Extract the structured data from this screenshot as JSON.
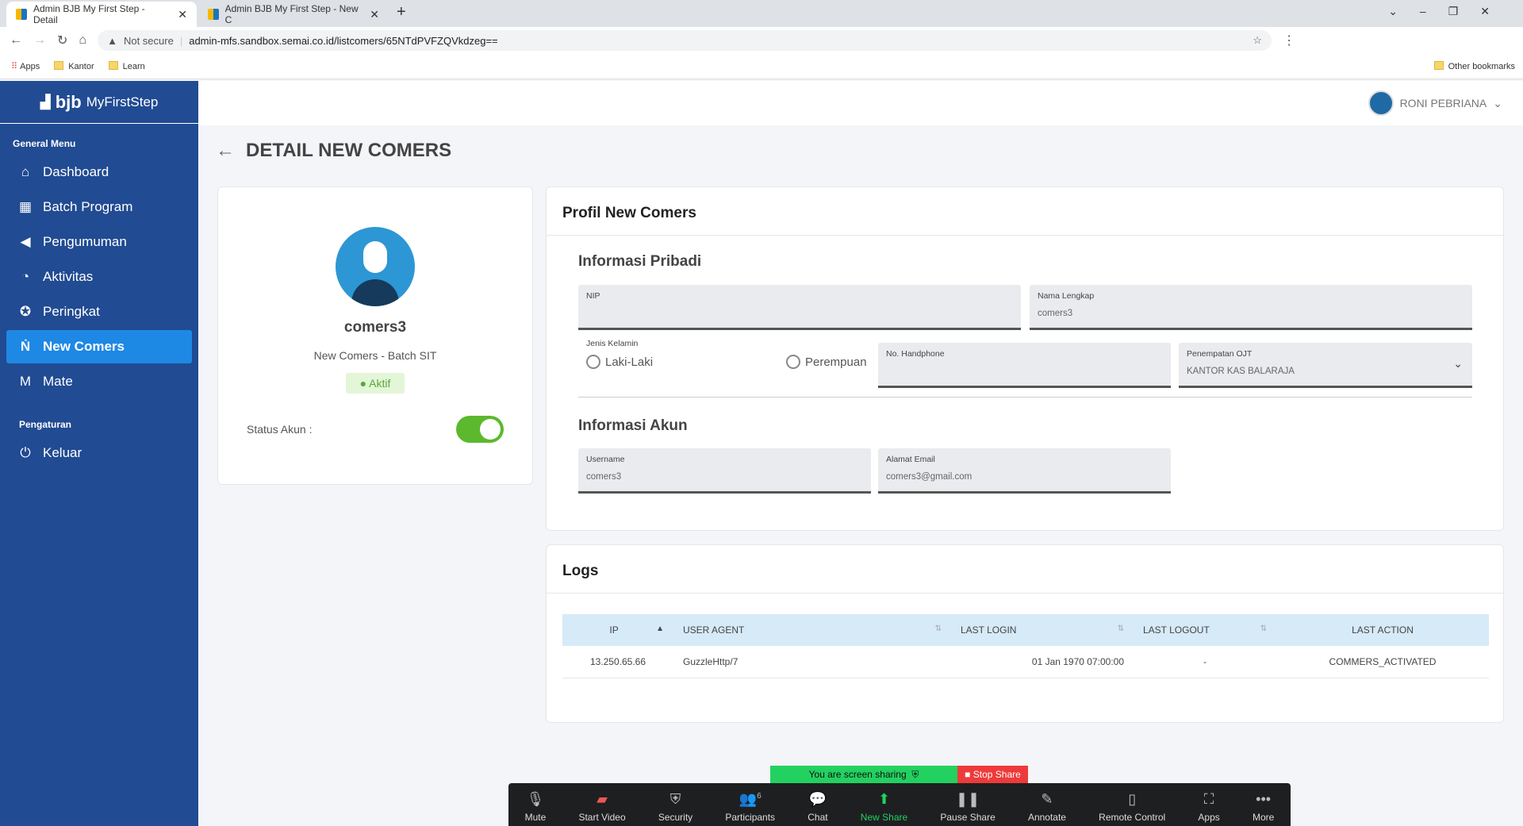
{
  "browser": {
    "tabs": [
      {
        "title": "Admin BJB My First Step - Detail"
      },
      {
        "title": "Admin BJB My First Step - New C"
      }
    ],
    "security": "Not secure",
    "url": "admin-mfs.sandbox.semai.co.id/listcomers/65NTdPVFZQVkdzeg==",
    "bookmarks": [
      "Apps",
      "Kantor",
      "Learn"
    ],
    "other_bookmarks": "Other bookmarks"
  },
  "sidebar": {
    "logo_bold": "bjb",
    "logo_text": "MyFirstStep",
    "section1": "General Menu",
    "items": [
      {
        "label": "Dashboard",
        "icon": "home-icon"
      },
      {
        "label": "Batch Program",
        "icon": "calendar-icon"
      },
      {
        "label": "Pengumuman",
        "icon": "megaphone-icon"
      },
      {
        "label": "Aktivitas",
        "icon": "activity-icon"
      },
      {
        "label": "Peringkat",
        "icon": "award-icon"
      },
      {
        "label": "New Comers",
        "icon": "newcomers-icon",
        "active": true
      },
      {
        "label": "Mate",
        "icon": "mate-icon"
      }
    ],
    "section2": "Pengaturan",
    "logout": "Keluar"
  },
  "header": {
    "user": "RONI PEBRIANA"
  },
  "page": {
    "title": "DETAIL NEW COMERS"
  },
  "profile_card": {
    "name": "comers3",
    "subtitle": "New Comers - Batch SIT",
    "status": "Aktif",
    "status_label": "Status Akun :",
    "status_on": true,
    "accent": "#5cb82d"
  },
  "profile": {
    "title": "Profil New Comers",
    "personal": "Informasi Pribadi",
    "nip_label": "NIP",
    "nip": "",
    "name_label": "Nama Lengkap",
    "name": "comers3",
    "gender_label": "Jenis Kelamin",
    "gender_options": [
      "Laki-Laki",
      "Perempuan"
    ],
    "phone_label": "No. Handphone",
    "phone": "",
    "placement_label": "Penempatan OJT",
    "placement": "KANTOR KAS BALARAJA",
    "account": "Informasi Akun",
    "username_label": "Username",
    "username": "comers3",
    "email_label": "Alamat Email",
    "email": "comers3@gmail.com"
  },
  "logs": {
    "title": "Logs",
    "columns": [
      "IP",
      "USER AGENT",
      "LAST LOGIN",
      "LAST LOGOUT",
      "LAST ACTION"
    ],
    "rows": [
      [
        "13.250.65.66",
        "GuzzleHttp/7",
        "01 Jan 1970 07:00:00",
        "-",
        "COMMERS_ACTIVATED"
      ]
    ]
  },
  "zoom": {
    "sharing": "You are screen sharing",
    "stop": "Stop Share",
    "participants_count": "6",
    "buttons": [
      "Mute",
      "Start Video",
      "Security",
      "Participants",
      "Chat",
      "New Share",
      "Pause Share",
      "Annotate",
      "Remote Control",
      "Apps",
      "More"
    ]
  }
}
